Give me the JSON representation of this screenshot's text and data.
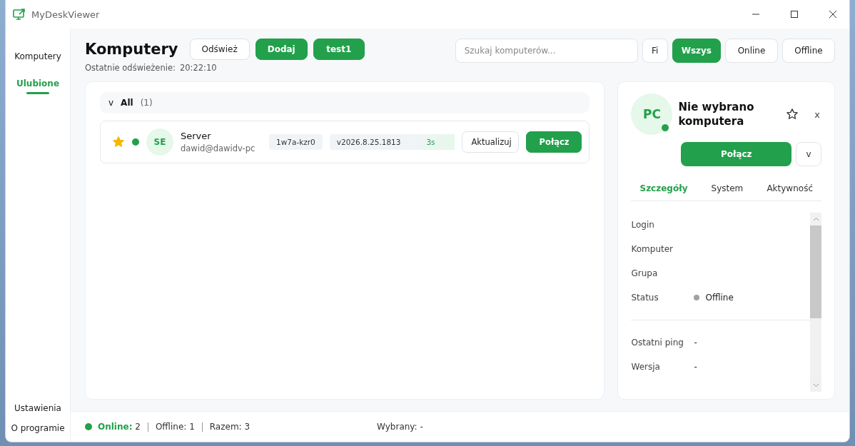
{
  "window": {
    "title": "MyDeskViewer"
  },
  "sidebar": {
    "items": [
      {
        "label": "Komputery",
        "selected": false
      },
      {
        "label": "Ulubione",
        "selected": true
      }
    ],
    "bottom_items": [
      {
        "label": "Ustawienia"
      },
      {
        "label": "O programie"
      }
    ]
  },
  "header": {
    "title": "Komputery",
    "buttons": [
      {
        "label": "Odśwież",
        "kind": "outline"
      },
      {
        "label": "Dodaj",
        "kind": "primary"
      },
      {
        "label": "test1",
        "kind": "primary"
      }
    ],
    "refresh_label": "Ostatnie odświeżenie:",
    "refresh_time": "20:22:10"
  },
  "search": {
    "placeholder": "Szukaj komputerów..."
  },
  "filters": [
    {
      "label": "Fi",
      "selected": false
    },
    {
      "label": "Wszys",
      "selected": true
    },
    {
      "label": "Online",
      "selected": false
    },
    {
      "label": "Offline",
      "selected": false
    }
  ],
  "groups": [
    {
      "toggle": "v",
      "name": "All",
      "count": "(1)",
      "expanded": true,
      "computers": [
        {
          "favorite": true,
          "online": true,
          "initials": "SE",
          "name": "Server",
          "user": "dawid@dawidv-pc",
          "id": "1w7a-kzr0",
          "version": "v2026.8.25.1813",
          "ping": "3s",
          "update_label": "Aktualizuj",
          "connect_label": "Połącz"
        }
      ]
    }
  ],
  "details": {
    "initials": "PC",
    "online": true,
    "title": "Nie wybrano komputera",
    "favorite": false,
    "close": "x",
    "connect_label": "Połącz",
    "menu_toggle": "v",
    "tabs": [
      {
        "label": "Szczegóły",
        "selected": true
      },
      {
        "label": "System",
        "selected": false
      },
      {
        "label": "Aktywność",
        "selected": false
      }
    ],
    "fields": [
      {
        "label": "Login"
      },
      {
        "label": "Komputer"
      },
      {
        "label": "Grupa"
      },
      {
        "label": "Status",
        "value": "Offline",
        "online": false
      }
    ],
    "fields2": [
      {
        "label": "Ostatni ping",
        "value": "-"
      },
      {
        "label": "Wersja",
        "value": "-"
      }
    ]
  },
  "status_bar": {
    "online_label": "Online:",
    "online_count": "2",
    "offline": "Offline: 1",
    "total": "Razem: 3",
    "selected": "Wybrany: -"
  }
}
